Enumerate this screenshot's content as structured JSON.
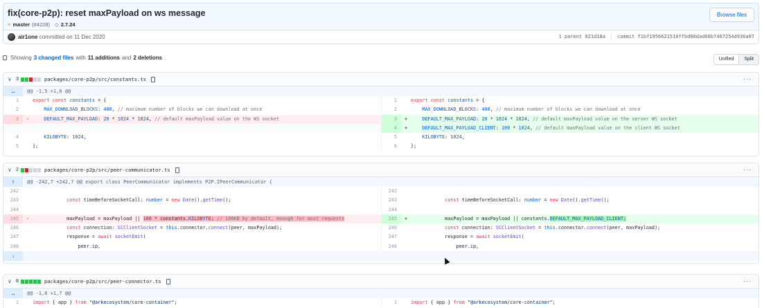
{
  "commit": {
    "title": "fix(core-p2p): reset maxPayload on ws message",
    "branch": "master",
    "pr": "(#4228)",
    "tag": "2.7.24",
    "browse_label": "Browse files",
    "author": "air1one",
    "committed_text": "committed on 11 Dec 2020",
    "parent_text": "1 parent 021d18a",
    "commit_text": "commit f1bf1956621510ffbd00dad66b7467254d936a07"
  },
  "summary": {
    "prefix": "Showing",
    "changed_files": "3 changed files",
    "with": "with",
    "additions": "11 additions",
    "and": "and",
    "deletions": "2 deletions",
    "view_unified": "Unified",
    "view_split": "Split"
  },
  "files": [
    {
      "count": "3",
      "path": "packages/core-p2p/src/constants.ts",
      "hunk": "@@ -1,5 +1,6 @@"
    },
    {
      "count": "2",
      "path": "packages/core-p2p/src/peer-communicator.ts",
      "hunk": "@@ -242,7 +242,7 @@ export class PeerCommunicator implements P2P.IPeerCommunicator {"
    },
    {
      "count": "8",
      "path": "packages/core-p2p/src/peer-connector.ts",
      "hunk": "@@ -1,6 +1,7 @@"
    }
  ],
  "colors": {
    "added": "#2cbe4e",
    "deleted": "#cb2431",
    "link": "#0366d6"
  }
}
